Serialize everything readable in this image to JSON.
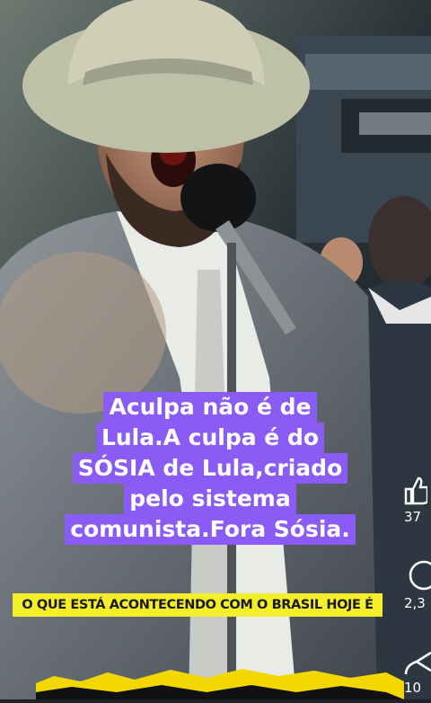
{
  "caption": {
    "lines": [
      "Aculpa não é de",
      "Lula.A culpa é do",
      "SÓSIA de Lula,criado",
      "pelo sistema",
      "comunista.Fora Sósia."
    ]
  },
  "ticker": {
    "text": "O QUE ESTÁ ACONTECENDO COM O BRASIL HOJE É"
  },
  "side_actions": {
    "like": {
      "icon": "thumbs-up-icon",
      "count": "37"
    },
    "comment": {
      "icon": "comment-icon",
      "count": "2,3"
    },
    "share": {
      "icon": "share-icon",
      "count": "10"
    }
  },
  "colors": {
    "caption_bg": "#8a5cf5",
    "ticker_bg": "#f4ef2a",
    "torn_edge": "#f2d700"
  }
}
